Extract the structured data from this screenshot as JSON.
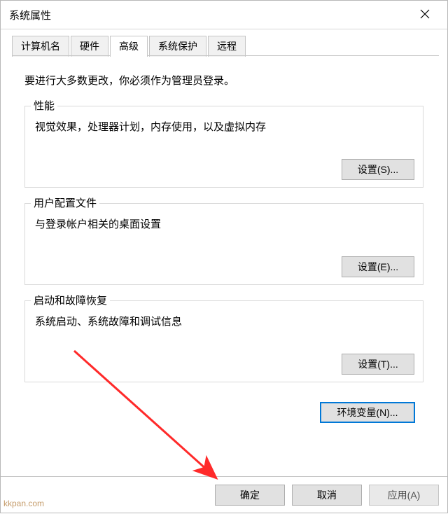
{
  "window": {
    "title": "系统属性"
  },
  "tabs": [
    {
      "label": "计算机名"
    },
    {
      "label": "硬件"
    },
    {
      "label": "高级",
      "active": true
    },
    {
      "label": "系统保护"
    },
    {
      "label": "远程"
    }
  ],
  "page": {
    "intro": "要进行大多数更改，你必须作为管理员登录。",
    "sections": [
      {
        "title": "性能",
        "desc": "视觉效果，处理器计划，内存使用，以及虚拟内存",
        "button": "设置(S)..."
      },
      {
        "title": "用户配置文件",
        "desc": "与登录帐户相关的桌面设置",
        "button": "设置(E)..."
      },
      {
        "title": "启动和故障恢复",
        "desc": "系统启动、系统故障和调试信息",
        "button": "设置(T)..."
      }
    ],
    "env_button": "环境变量(N)..."
  },
  "footer": {
    "ok": "确定",
    "cancel": "取消",
    "apply": "应用(A)"
  },
  "watermark": "kkpan.com"
}
